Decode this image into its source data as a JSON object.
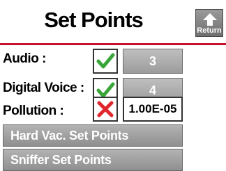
{
  "header": {
    "title": "Set Points",
    "return_label": "Return"
  },
  "rows": [
    {
      "label": "Audio :",
      "checked": true,
      "value": "3"
    },
    {
      "label": "Digital Voice :",
      "checked": true,
      "value": "4"
    },
    {
      "label": "Pollution :",
      "checked": false,
      "value": "1.00E-05"
    }
  ],
  "buttons": {
    "hard_vac": "Hard Vac. Set Points",
    "sniffer": "Sniffer Set Points"
  },
  "colors": {
    "accent_red": "#c4122f",
    "check_green": "#3aa63a",
    "cross_red": "#e0262d"
  }
}
